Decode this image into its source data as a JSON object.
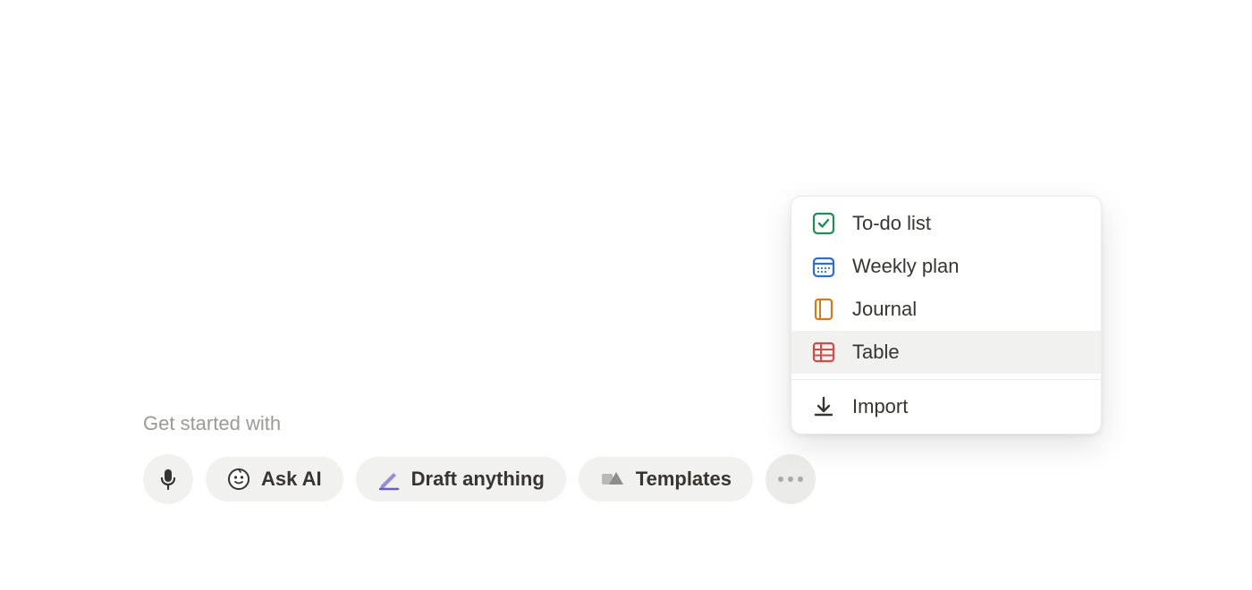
{
  "prompt_label": "Get started with",
  "starters": {
    "ask_ai": "Ask AI",
    "draft": "Draft anything",
    "templates": "Templates"
  },
  "menu": {
    "items": [
      {
        "label": "To-do list"
      },
      {
        "label": "Weekly plan"
      },
      {
        "label": "Journal"
      },
      {
        "label": "Table"
      }
    ],
    "import": "Import",
    "hovered_index": 3
  },
  "colors": {
    "todo": "#228b57",
    "weekly": "#2d6fd0",
    "journal": "#d47b1b",
    "table": "#d44c47",
    "import": "#37352f"
  }
}
